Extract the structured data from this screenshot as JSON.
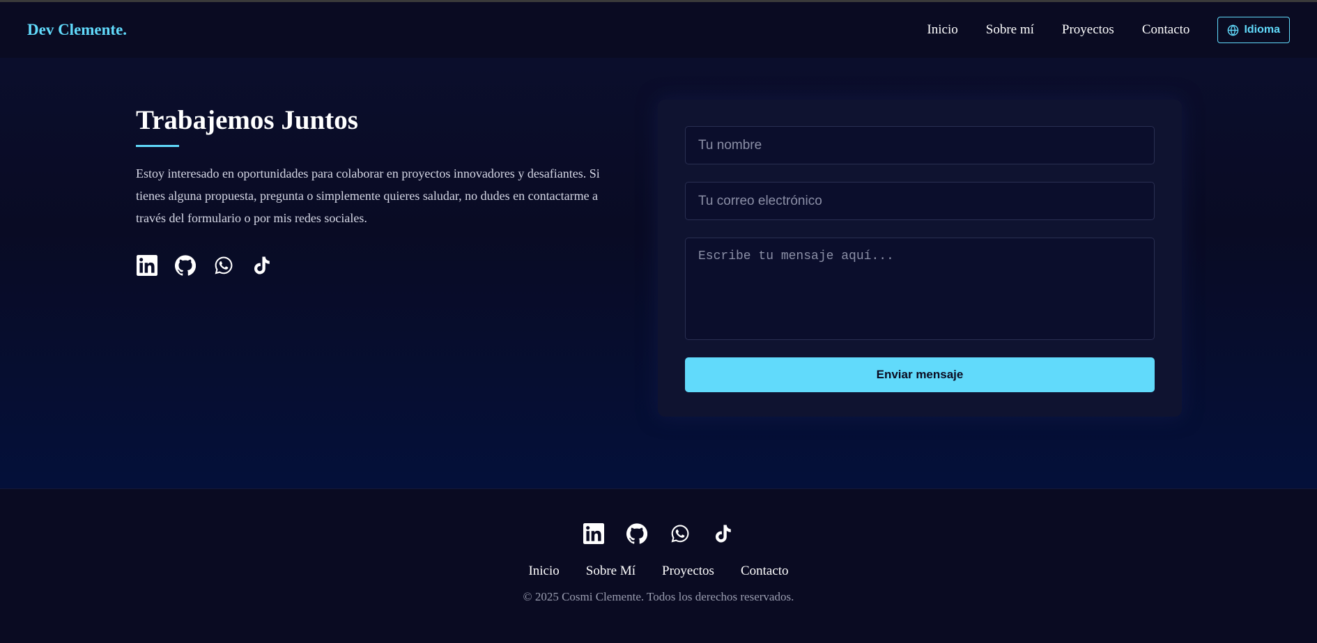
{
  "brand": "Dev Clemente.",
  "nav": {
    "items": [
      {
        "label": "Inicio"
      },
      {
        "label": "Sobre mí"
      },
      {
        "label": "Proyectos"
      },
      {
        "label": "Contacto"
      }
    ],
    "language_label": "Idioma",
    "language_icon": "globe-icon"
  },
  "contact": {
    "title": "Trabajemos Juntos",
    "description": "Estoy interesado en oportunidades para colaborar en proyectos innovadores y desafiantes. Si tienes alguna propuesta, pregunta o simplemente quieres saludar, no dudes en contactarme a través del formulario o por mis redes sociales.",
    "socials": [
      "linkedin-icon",
      "github-icon",
      "whatsapp-icon",
      "tiktok-icon"
    ],
    "form": {
      "name_placeholder": "Tu nombre",
      "email_placeholder": "Tu correo electrónico",
      "message_placeholder": "Escribe tu mensaje aquí...",
      "submit_label": "Enviar mensaje"
    }
  },
  "footer": {
    "socials": [
      "linkedin-icon",
      "github-icon",
      "whatsapp-icon",
      "tiktok-icon"
    ],
    "links": [
      {
        "label": "Inicio"
      },
      {
        "label": "Sobre Mí"
      },
      {
        "label": "Proyectos"
      },
      {
        "label": "Contacto"
      }
    ],
    "copyright": "© 2025 Cosmi Clemente. Todos los derechos reservados."
  },
  "colors": {
    "accent": "#61dafb",
    "background": "#0a0b20",
    "card": "#0f1330"
  }
}
